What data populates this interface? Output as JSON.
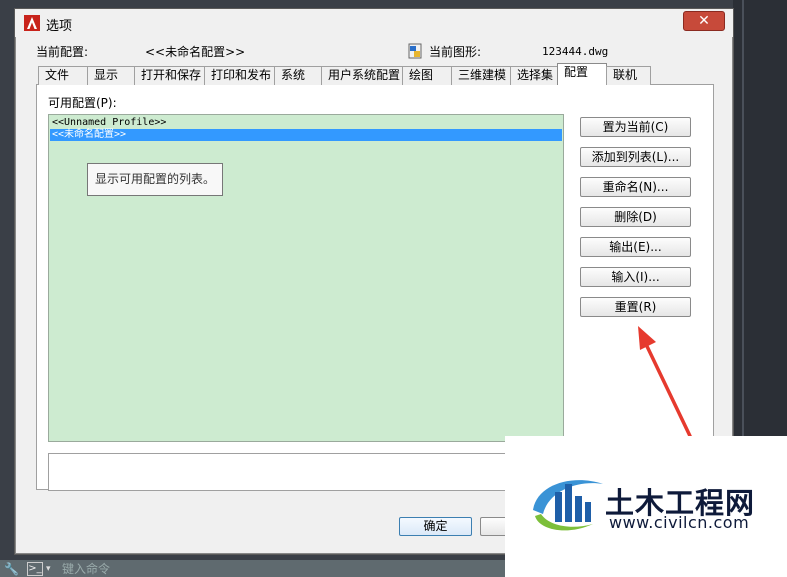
{
  "window": {
    "title": "选项",
    "close_glyph": "✕",
    "icon": "autocad-icon"
  },
  "header": {
    "current_profile_label": "当前配置:",
    "current_profile_value": "<<未命名配置>>",
    "current_drawing_label": "当前图形:",
    "current_drawing_value": "123444.dwg"
  },
  "tabs": [
    {
      "label": "文件"
    },
    {
      "label": "显示"
    },
    {
      "label": "打开和保存"
    },
    {
      "label": "打印和发布"
    },
    {
      "label": "系统"
    },
    {
      "label": "用户系统配置"
    },
    {
      "label": "绘图"
    },
    {
      "label": "三维建模"
    },
    {
      "label": "选择集"
    },
    {
      "label": "配置",
      "active": true
    },
    {
      "label": "联机"
    }
  ],
  "profiles": {
    "label": "可用配置(P):",
    "items": [
      "<<Unnamed Profile>>",
      "<<未命名配置>>"
    ],
    "selected_index": 1,
    "tooltip": "显示可用配置的列表。"
  },
  "side_buttons": [
    {
      "label": "置为当前(C)"
    },
    {
      "label": "添加到列表(L)..."
    },
    {
      "label": "重命名(N)..."
    },
    {
      "label": "删除(D)"
    },
    {
      "label": "输出(E)..."
    },
    {
      "label": "输入(I)..."
    },
    {
      "label": "重置(R)"
    }
  ],
  "footer": {
    "ok_label": "确定"
  },
  "command_line": {
    "placeholder": "键入命令"
  },
  "watermark": {
    "name": "土木工程网",
    "url": "www.civilcn.com"
  },
  "colors": {
    "list_bg": "#cdebd0",
    "selection": "#3399ff",
    "arrow": "#e63a2e",
    "close": "#c74a3a"
  }
}
